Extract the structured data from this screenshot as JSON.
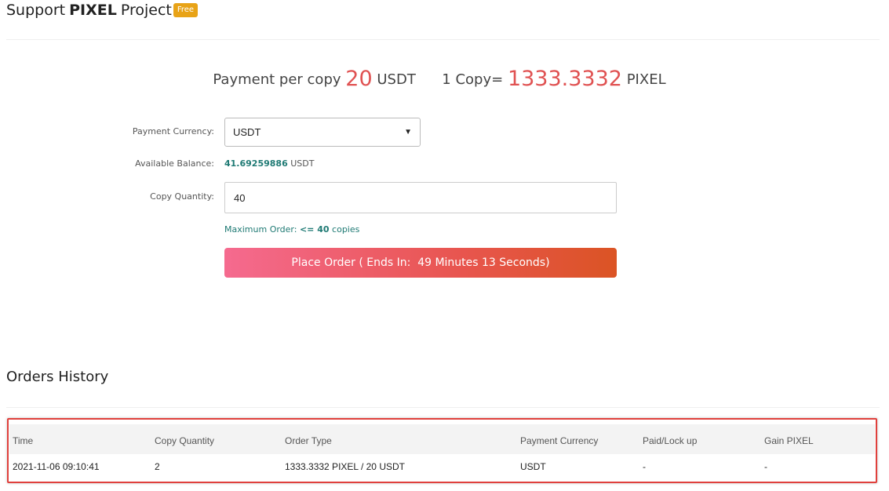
{
  "header": {
    "title_prefix": "Support",
    "title_bold": "PIXEL",
    "title_suffix": "Project",
    "badge": "Free"
  },
  "price": {
    "per_copy_label": "Payment per copy",
    "per_copy_value": "20",
    "per_copy_unit": "USDT",
    "copy_label": "1 Copy=",
    "copy_value": "1333.3332",
    "copy_unit": "PIXEL"
  },
  "form": {
    "currency_label": "Payment Currency:",
    "currency_selected": "USDT",
    "balance_label": "Available Balance:",
    "balance_value": "41.69259886",
    "balance_unit": "USDT",
    "quantity_label": "Copy Quantity:",
    "quantity_value": "40",
    "max_order_prefix": "Maximum Order:",
    "max_order_value": "<= 40",
    "max_order_suffix": "copies",
    "order_button": "Place Order ( Ends In:  49 Minutes 13 Seconds)"
  },
  "history": {
    "title": "Orders History",
    "columns": [
      "Time",
      "Copy Quantity",
      "Order Type",
      "Payment Currency",
      "Paid/Lock up",
      "Gain PIXEL"
    ],
    "rows": [
      [
        "2021-11-06 09:10:41",
        "2",
        "1333.3332 PIXEL / 20 USDT",
        "USDT",
        "-",
        "-"
      ]
    ]
  },
  "colors": {
    "accent_red": "#e05252",
    "teal": "#1f7a74",
    "badge": "#e8a317",
    "annotation_box": "#e0403c"
  },
  "icons": {
    "select_arrow": "chevron-down-icon"
  }
}
